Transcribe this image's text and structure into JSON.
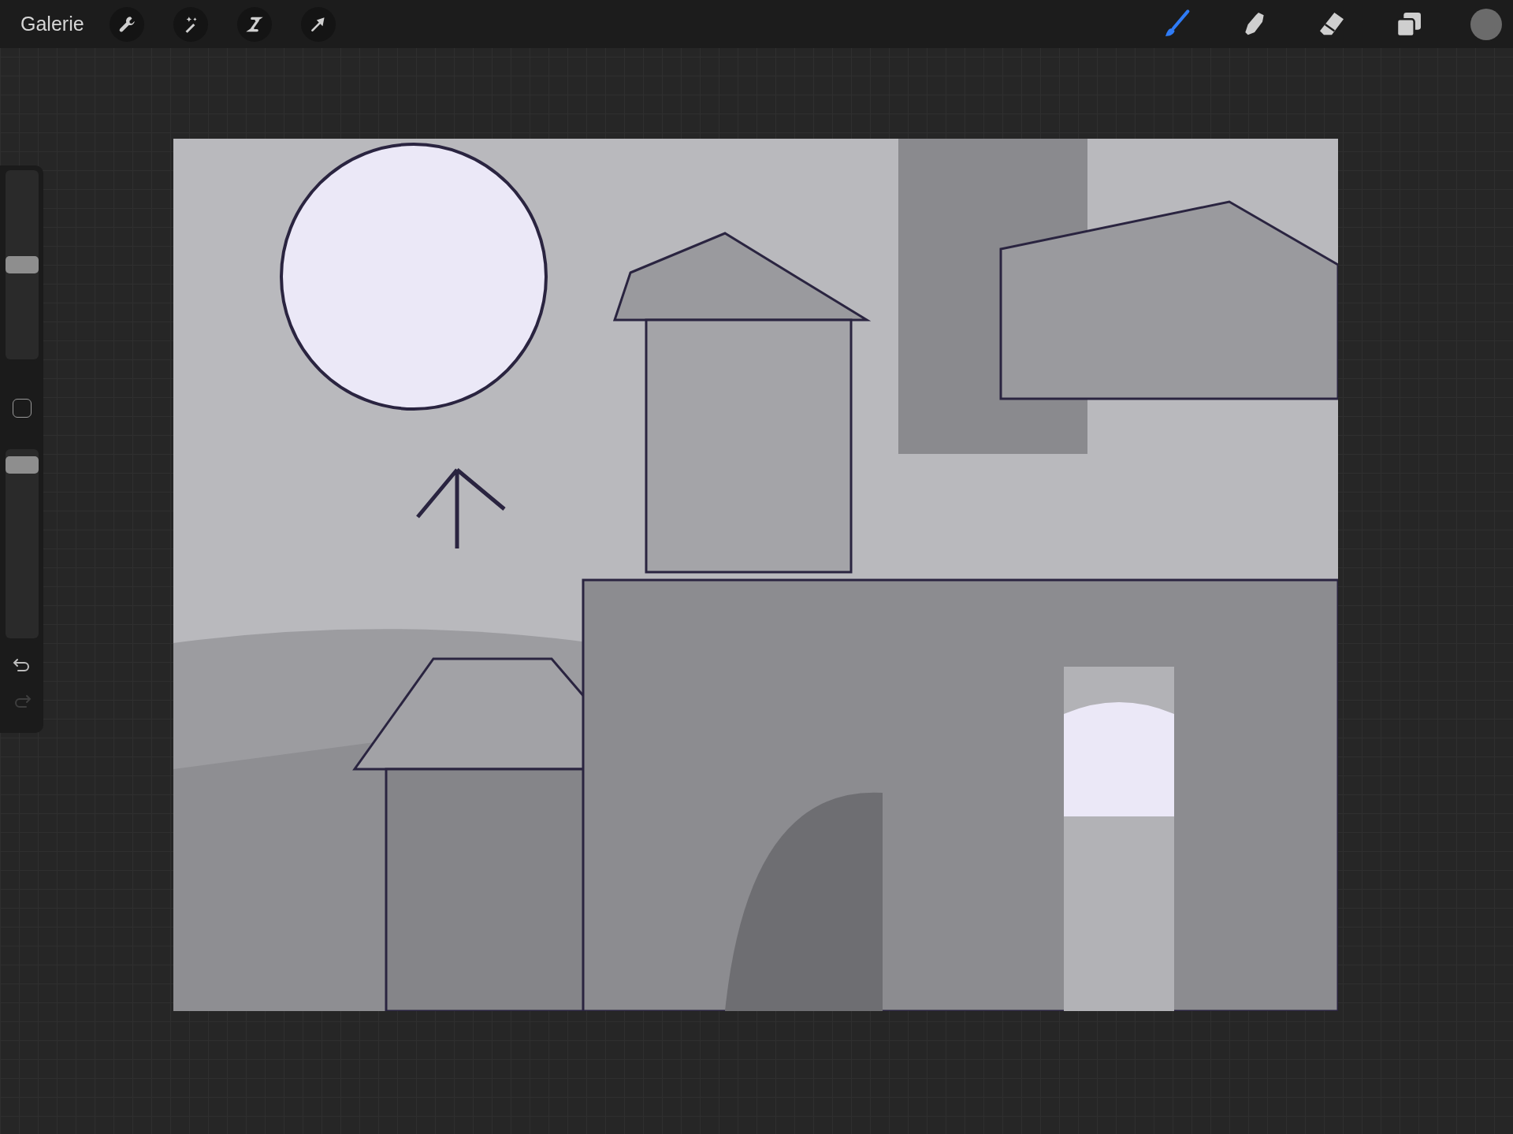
{
  "toolbar": {
    "gallery": "Galerie",
    "actions": [
      {
        "kind": "wrench"
      },
      {
        "kind": "wand"
      },
      {
        "kind": "select"
      },
      {
        "kind": "move"
      }
    ],
    "tools": [
      {
        "kind": "brush",
        "selected": true
      },
      {
        "kind": "smudge",
        "selected": false
      },
      {
        "kind": "eraser",
        "selected": false
      }
    ],
    "current_color": {
      "color": "#6b6b6b"
    }
  },
  "sidebar": {
    "size_slider": {
      "level": 0.5
    },
    "opacity_slider": {
      "level": 0.96
    },
    "undo": {
      "disabled": false
    },
    "redo": {
      "disabled": true
    }
  }
}
